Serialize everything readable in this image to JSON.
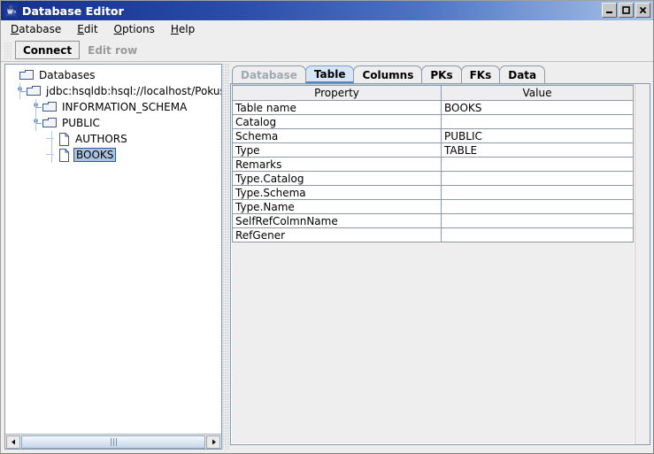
{
  "window": {
    "title": "Database Editor",
    "app_icon": "java-coffee-cup-icon",
    "minimize_label": "–",
    "maximize_label": "❐",
    "close_label": "✕"
  },
  "menubar": {
    "items": [
      {
        "label": "Database",
        "mnemonic": "D"
      },
      {
        "label": "Edit",
        "mnemonic": "E"
      },
      {
        "label": "Options",
        "mnemonic": "O"
      },
      {
        "label": "Help",
        "mnemonic": "H"
      }
    ]
  },
  "toolbar": {
    "grip": "drag-grip-icon",
    "buttons": [
      {
        "label": "Connect",
        "enabled": true
      },
      {
        "label": "Edit row",
        "enabled": false
      }
    ]
  },
  "tree": {
    "nodes": [
      {
        "label": "Databases",
        "depth": 0,
        "icon": "folder-icon",
        "expander": "none",
        "selected": false
      },
      {
        "label": "jdbc:hsqldb:hsql://localhost/PokusDB",
        "depth": 1,
        "icon": "folder-icon",
        "expander": "expanded",
        "selected": false
      },
      {
        "label": "INFORMATION_SCHEMA",
        "depth": 2,
        "icon": "folder-icon",
        "expander": "expanded",
        "selected": false
      },
      {
        "label": "PUBLIC",
        "depth": 2,
        "icon": "folder-icon",
        "expander": "expanded",
        "selected": false
      },
      {
        "label": "AUTHORS",
        "depth": 3,
        "icon": "file-icon",
        "expander": "leaf",
        "selected": false
      },
      {
        "label": "BOOKS",
        "depth": 3,
        "icon": "file-icon",
        "expander": "leaf",
        "selected": true
      }
    ],
    "hscrollbar": {
      "left_arrow": "◀",
      "right_arrow": "▶",
      "thumb_grip": "scroll-thumb-grip-icon"
    }
  },
  "tabs": [
    {
      "label": "Database",
      "state": "disabled"
    },
    {
      "label": "Table",
      "state": "active"
    },
    {
      "label": "Columns",
      "state": "normal"
    },
    {
      "label": "PKs",
      "state": "normal"
    },
    {
      "label": "FKs",
      "state": "normal"
    },
    {
      "label": "Data",
      "state": "normal"
    }
  ],
  "table": {
    "columns": [
      "Property",
      "Value"
    ],
    "rows": [
      [
        "Table name",
        "BOOKS"
      ],
      [
        "Catalog",
        ""
      ],
      [
        "Schema",
        "PUBLIC"
      ],
      [
        "Type",
        "TABLE"
      ],
      [
        "Remarks",
        ""
      ],
      [
        "Type.Catalog",
        ""
      ],
      [
        "Type.Schema",
        ""
      ],
      [
        "Type.Name",
        ""
      ],
      [
        "SelfRefColmnName",
        ""
      ],
      [
        "RefGener",
        ""
      ]
    ]
  },
  "colors": {
    "title_bar_start": "#13308c",
    "title_bar_end": "#a8c4e8",
    "active_tab_bg": "#d6e6f7",
    "selection_bg": "#aac4e0",
    "selection_border": "#2a5a9a",
    "panel_bg": "#eeeeee",
    "border": "#8a9aaa"
  }
}
